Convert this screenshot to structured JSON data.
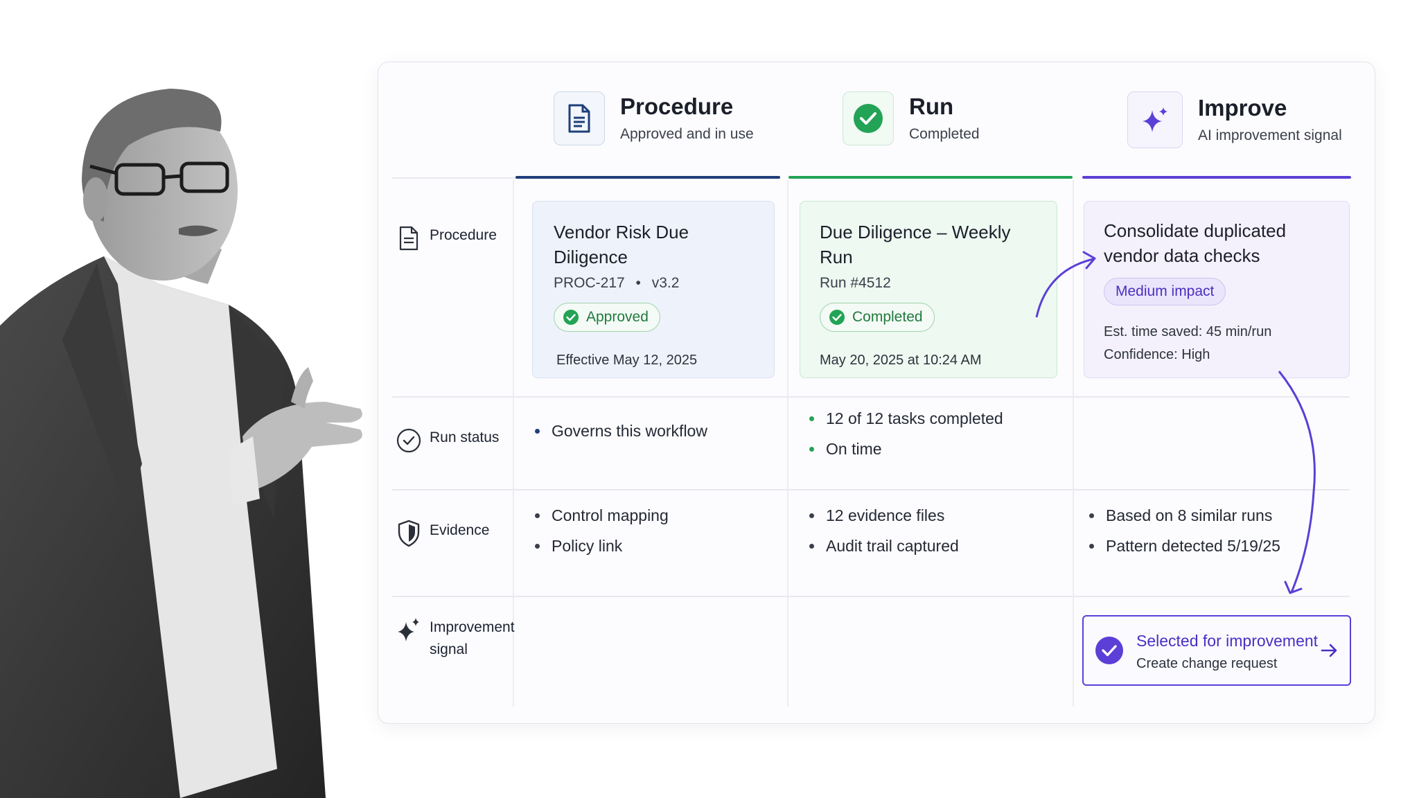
{
  "columns": {
    "procedure": {
      "title": "Procedure",
      "subtitle": "Approved and in use",
      "icon": "document-icon",
      "accent": "#1f3f7a"
    },
    "run": {
      "title": "Run",
      "subtitle": "Completed",
      "icon": "check-circle-icon",
      "accent": "#22a355"
    },
    "improve": {
      "title": "Improve",
      "subtitle": "AI improvement signal",
      "icon": "sparkle-icon",
      "accent": "#5b3fd6"
    }
  },
  "rows": {
    "procedure": {
      "label": "Procedure",
      "icon": "document-icon"
    },
    "run_status": {
      "label": "Run status",
      "icon": "check-circle-outline-icon"
    },
    "evidence": {
      "label": "Evidence",
      "icon": "shield-icon"
    },
    "improvement_signal": {
      "label_line1": "Improvement",
      "label_line2": "signal",
      "icon": "sparkle-icon"
    }
  },
  "procedure_card": {
    "title": "Vendor Risk Due Diligence",
    "id": "PROC-217",
    "separator": "•",
    "version": "v3.2",
    "badge": "Approved",
    "effective": "Effective May 12, 2025"
  },
  "run_card": {
    "title": "Due Diligence – Weekly Run",
    "run_id": "Run #4512",
    "badge": "Completed",
    "timestamp": "May 20, 2025 at 10:24 AM"
  },
  "improve_card": {
    "title_line1": "Consolidate duplicated",
    "title_line2": "vendor data checks",
    "badge": "Medium impact",
    "time_saved": "Est. time saved: 45 min/run",
    "confidence": "Confidence: High"
  },
  "run_status": {
    "procedure": [
      "Governs this workflow"
    ],
    "run": [
      "12 of 12 tasks completed",
      "On time"
    ]
  },
  "evidence": {
    "procedure": [
      "Control mapping",
      "Policy link"
    ],
    "run": [
      "12 evidence files",
      "Audit trail captured"
    ],
    "improve": [
      "Based on 8 similar runs",
      "Pattern detected 5/19/25"
    ]
  },
  "cta": {
    "title": "Selected for improvement",
    "subtitle": "Create change request",
    "icon": "arrow-right-icon"
  },
  "colors": {
    "navy": "#1f3f7a",
    "green": "#22a355",
    "purple": "#5b3fd6"
  }
}
